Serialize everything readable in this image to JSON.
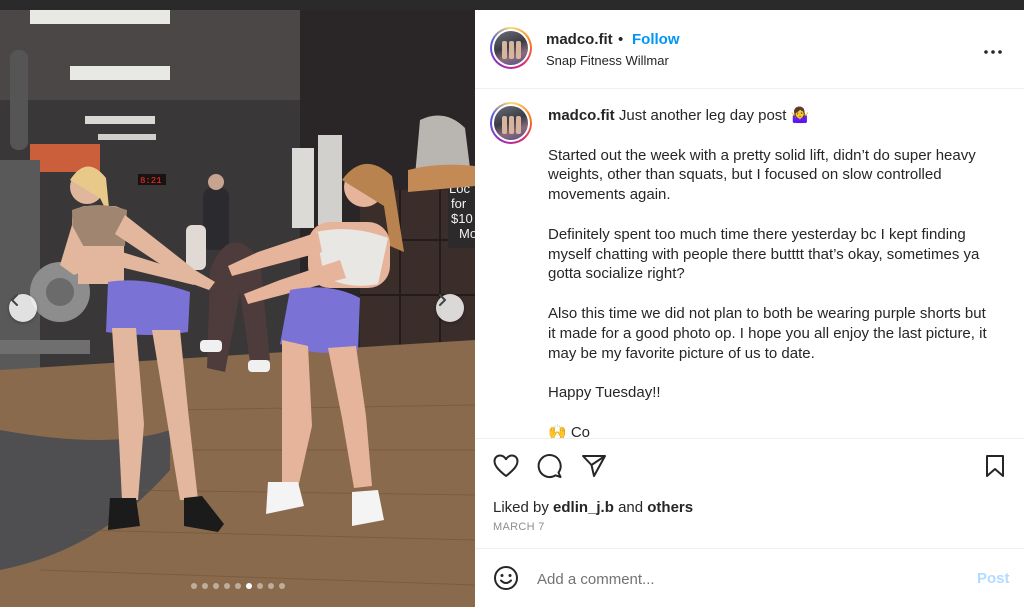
{
  "post": {
    "username": "madco.fit",
    "separator": "•",
    "follow_label": "Follow",
    "location": "Snap Fitness Willmar",
    "more_label": "More options"
  },
  "photo": {
    "sign_text": [
      "Loc",
      "for",
      "$10",
      "Mo"
    ],
    "clock_text": "8:21",
    "carousel": {
      "total": 9,
      "active": 6
    }
  },
  "caption": {
    "username": "madco.fit",
    "first_line": "Just another leg day post 🤷‍♀️",
    "paragraphs": [
      "Started out the week with a pretty solid lift, didn’t do super heavy weights, other than squats, but I focused on slow controlled movements again.",
      "Definitely spent too much time there yesterday bc I kept finding myself chatting with people there butttt that’s okay, sometimes ya gotta socialize right?",
      "Also this time we did not plan to both be wearing purple shorts but it made for a good photo op. I hope you all enjoy the last picture, it may be my favorite picture of us to date.",
      "Happy Tuesday!!",
      "🙌 Co"
    ]
  },
  "engagement": {
    "liked_prefix": "Liked by",
    "liked_user": "edlin_j.b",
    "liked_and": "and",
    "liked_others": "others",
    "date": "MARCH 7"
  },
  "comment": {
    "placeholder": "Add a comment...",
    "post_label": "Post"
  },
  "colors": {
    "accent": "#0095f6",
    "post_disabled": "#b3dbff",
    "shorts": "#7b72d6"
  }
}
